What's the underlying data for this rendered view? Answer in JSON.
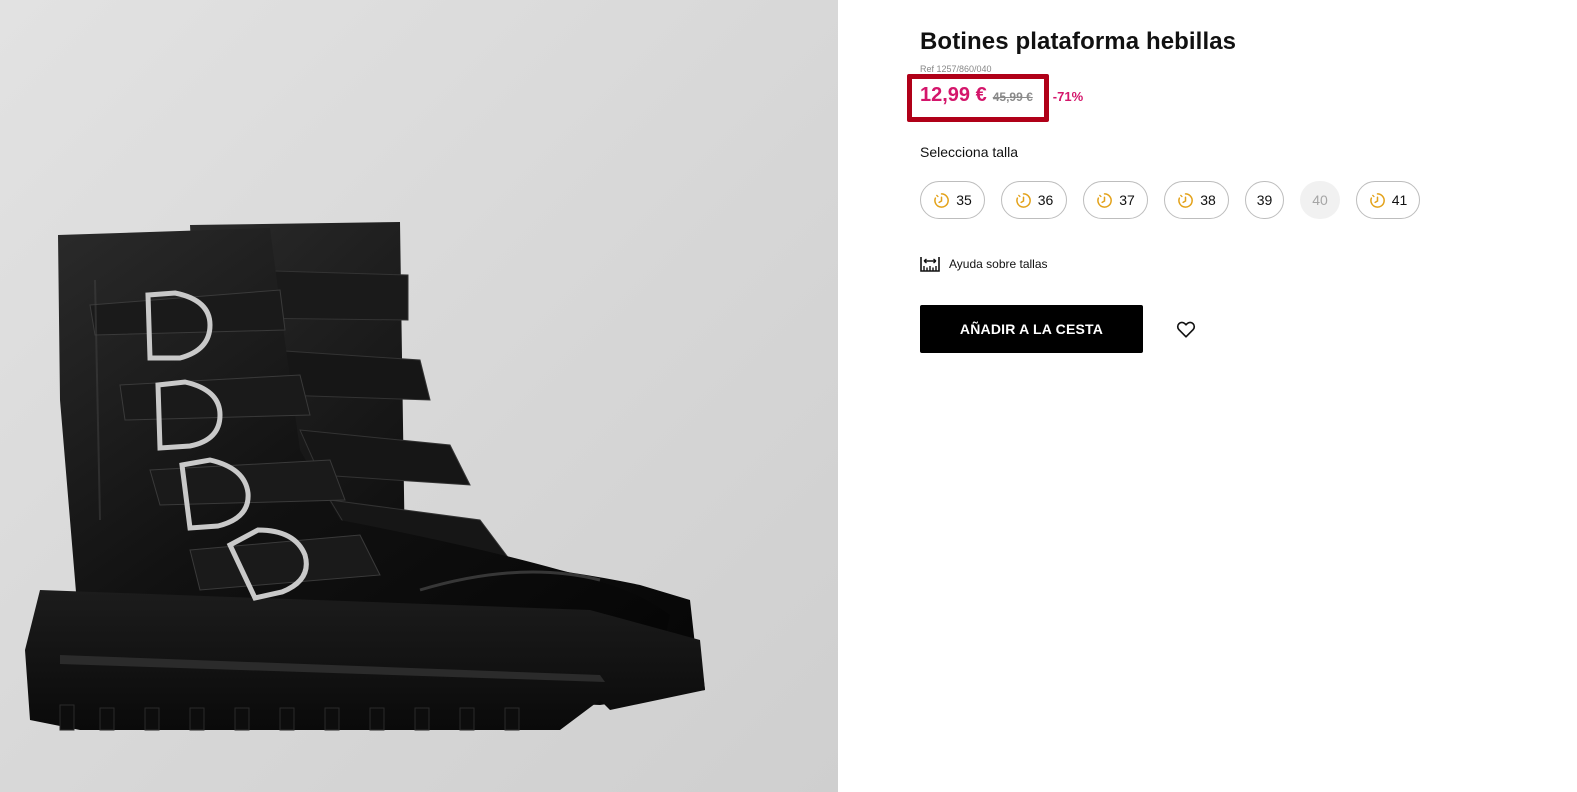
{
  "product": {
    "title": "Botines plataforma hebillas",
    "ref": "Ref 1257/860/040",
    "price_current": "12,99 €",
    "price_old": "45,99 €",
    "discount": "-71%",
    "image_alt": "black-platform-buckle-boots-photo"
  },
  "sizes": {
    "label": "Selecciona talla",
    "options": [
      {
        "label": "35",
        "icon": "clock-icon",
        "available": true
      },
      {
        "label": "36",
        "icon": "clock-icon",
        "available": true
      },
      {
        "label": "37",
        "icon": "clock-icon",
        "available": true
      },
      {
        "label": "38",
        "icon": "clock-icon",
        "available": true
      },
      {
        "label": "39",
        "icon": "",
        "available": true
      },
      {
        "label": "40",
        "icon": "",
        "available": false
      },
      {
        "label": "41",
        "icon": "clock-icon",
        "available": true
      }
    ]
  },
  "size_help": {
    "label": "Ayuda sobre tallas",
    "icon": "ruler-icon"
  },
  "actions": {
    "add_to_cart": "AÑADIR A LA CESTA",
    "wishlist_icon": "heart-icon"
  },
  "colors": {
    "sale_price": "#d4166b",
    "highlight": "#b00018",
    "clock_icon": "#e3a21a",
    "button_bg": "#000000"
  }
}
